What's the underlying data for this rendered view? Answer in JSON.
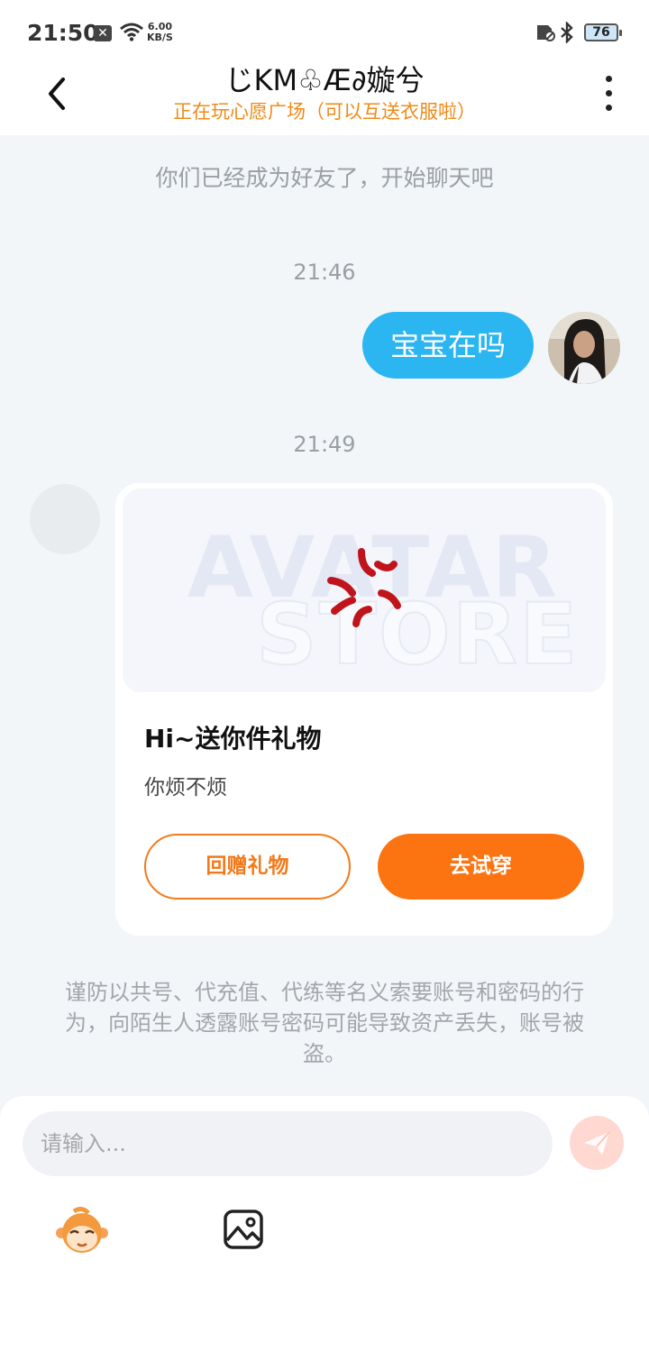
{
  "status_bar": {
    "time": "21:50",
    "net_speed_value": "6.00",
    "net_speed_unit": "KB/S",
    "battery": "76"
  },
  "header": {
    "title": "じKM♧Æ∂嫙兮",
    "subtitle": "正在玩心愿广场（可以互送衣服啦）"
  },
  "chat": {
    "friend_notice": "你们已经成为好友了，开始聊天吧",
    "messages": [
      {
        "timestamp": "21:46",
        "text": "宝宝在吗",
        "from": "me"
      },
      {
        "timestamp": "21:49",
        "from": "them"
      }
    ],
    "gift_card": {
      "watermark_top": "AVATAR",
      "watermark_bottom": "STORE",
      "title": "Hi~送你件礼物",
      "message": "你烦不烦",
      "return_gift_label": "回赠礼物",
      "try_on_label": "去试穿"
    },
    "warning": "谨防以共号、代充值、代练等名义索要账号和密码的行为，向陌生人透露账号密码可能导致资产丢失，账号被盗。"
  },
  "input": {
    "placeholder": "请输入..."
  },
  "colors": {
    "accent_orange": "#fb7411",
    "bubble_blue": "#2bb6f1",
    "subtitle_orange": "#f08a16"
  },
  "icons": [
    "back-arrow-icon",
    "more-vertical-icon",
    "send-icon",
    "emoji-monkey-icon",
    "image-icon",
    "anger-symbol-icon"
  ]
}
